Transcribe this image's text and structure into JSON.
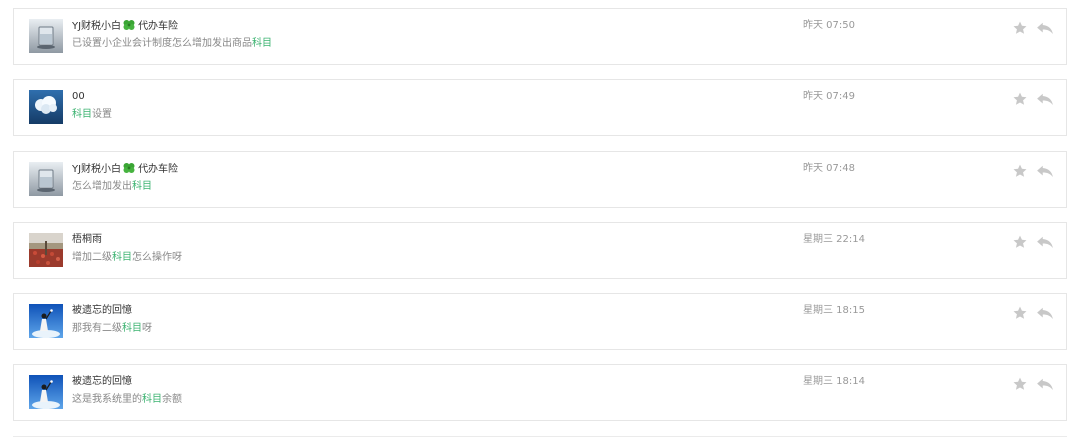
{
  "colors": {
    "highlight": "#3cb371",
    "icon": "#c8c8c8",
    "border": "#e6e6e6"
  },
  "messages": [
    {
      "avatar": "glass-avatar",
      "name": "YJ财税小白",
      "name_suffix": "代办车险",
      "has_clover": true,
      "text_before": "已设置小企业会计制度怎么增加发出商品",
      "keyword": "科目",
      "text_after": "",
      "time": "昨天 07:50"
    },
    {
      "avatar": "cloud-avatar",
      "name": "00",
      "name_suffix": "",
      "has_clover": false,
      "text_before": "",
      "keyword": "科目",
      "text_after": "设置",
      "time": "昨天 07:49"
    },
    {
      "avatar": "glass-avatar",
      "name": "YJ财税小白",
      "name_suffix": "代办车险",
      "has_clover": true,
      "text_before": "怎么增加发出",
      "keyword": "科目",
      "text_after": "",
      "time": "昨天 07:48"
    },
    {
      "avatar": "flower-field-avatar",
      "name": "梧桐雨",
      "name_suffix": "",
      "has_clover": false,
      "text_before": "增加二级",
      "keyword": "科目",
      "text_after": "怎么操作呀",
      "time": "星期三 22:14"
    },
    {
      "avatar": "sky-girl-avatar",
      "name": "被遗忘的回憶",
      "name_suffix": "",
      "has_clover": false,
      "text_before": "那我有二级",
      "keyword": "科目",
      "text_after": "呀",
      "time": "星期三 18:15"
    },
    {
      "avatar": "sky-girl-avatar",
      "name": "被遗忘的回憶",
      "name_suffix": "",
      "has_clover": false,
      "text_before": "这是我系统里的",
      "keyword": "科目",
      "text_after": "余额",
      "time": "星期三 18:14"
    }
  ]
}
